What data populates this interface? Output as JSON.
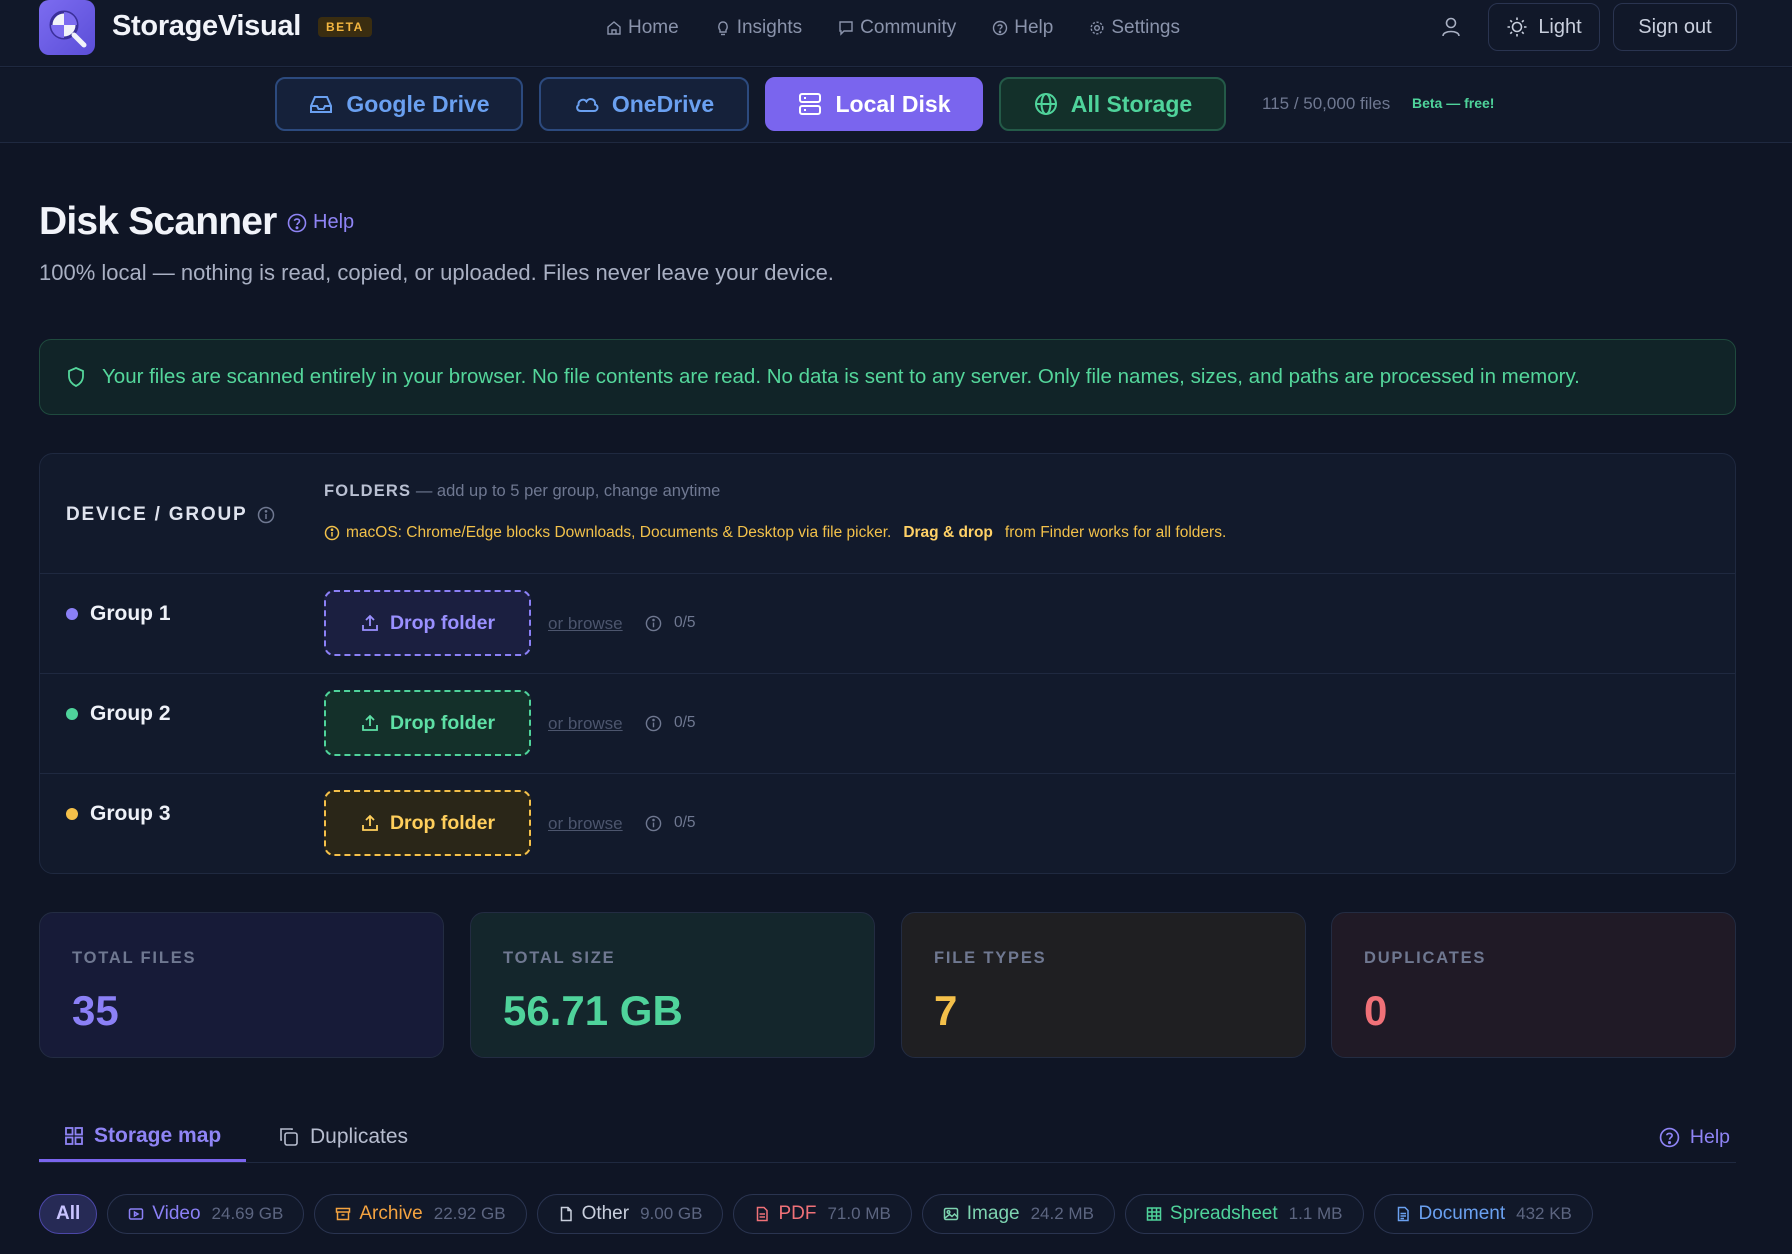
{
  "app": {
    "name": "StorageVisual",
    "badge": "BETA"
  },
  "nav": [
    {
      "label": "Home",
      "icon": "home-icon"
    },
    {
      "label": "Insights",
      "icon": "lightbulb-icon"
    },
    {
      "label": "Community",
      "icon": "chat-icon"
    },
    {
      "label": "Help",
      "icon": "help-icon"
    },
    {
      "label": "Settings",
      "icon": "gear-icon"
    }
  ],
  "header_actions": {
    "theme_label": "Light",
    "signout_label": "Sign out"
  },
  "sources": {
    "tabs": [
      {
        "label": "Google Drive",
        "icon": "drive-icon",
        "active": false
      },
      {
        "label": "OneDrive",
        "icon": "cloud-icon",
        "active": false
      },
      {
        "label": "Local Disk",
        "icon": "server-icon",
        "active": true
      },
      {
        "label": "All Storage",
        "icon": "globe-icon",
        "active": false
      }
    ],
    "file_count": "115 / 50,000 files",
    "beta_note": "Beta — free!"
  },
  "page": {
    "title": "Disk Scanner",
    "help_label": "Help",
    "subtitle": "100% local — nothing is read, copied, or uploaded. Files never leave your device.",
    "privacy_notice": "Your files are scanned entirely in your browser. No file contents are read. No data is sent to any server. Only file names, sizes, and paths are processed in memory."
  },
  "groups_panel": {
    "device_group_label": "DEVICE / GROUP",
    "folders_label": "FOLDERS",
    "folders_hint": "— add up to 5 per group, change anytime",
    "mac_note_before": "macOS: Chrome/Edge blocks Downloads, Documents & Desktop via file picker.",
    "mac_note_bold": "Drag & drop",
    "mac_note_after": "from Finder works for all folders.",
    "groups": [
      {
        "name": "Group 1",
        "drop_label": "Drop folder",
        "browse_label": "or browse",
        "count": "0/5",
        "color": "#8b80f6"
      },
      {
        "name": "Group 2",
        "drop_label": "Drop folder",
        "browse_label": "or browse",
        "count": "0/5",
        "color": "#4fd39b"
      },
      {
        "name": "Group 3",
        "drop_label": "Drop folder",
        "browse_label": "or browse",
        "count": "0/5",
        "color": "#f4c04a"
      }
    ]
  },
  "stats": [
    {
      "label": "TOTAL FILES",
      "value": "35",
      "color": "#8b80f6"
    },
    {
      "label": "TOTAL SIZE",
      "value": "56.71 GB",
      "color": "#4fd39b"
    },
    {
      "label": "FILE TYPES",
      "value": "7",
      "color": "#f4c04a"
    },
    {
      "label": "DUPLICATES",
      "value": "0",
      "color": "#f07178"
    }
  ],
  "view_tabs": {
    "storage_map": "Storage map",
    "duplicates": "Duplicates",
    "help": "Help"
  },
  "filters": [
    {
      "label": "All",
      "size": ""
    },
    {
      "label": "Video",
      "size": "24.69 GB",
      "color": "#8b80f6",
      "icon": "video-icon"
    },
    {
      "label": "Archive",
      "size": "22.92 GB",
      "color": "#f4a340",
      "icon": "archive-icon"
    },
    {
      "label": "Other",
      "size": "9.00 GB",
      "color": "#c9cfdd",
      "icon": "file-icon"
    },
    {
      "label": "PDF",
      "size": "71.0 MB",
      "color": "#f07178",
      "icon": "pdf-icon"
    },
    {
      "label": "Image",
      "size": "24.2 MB",
      "color": "#7dd3b0",
      "icon": "image-icon"
    },
    {
      "label": "Spreadsheet",
      "size": "1.1 MB",
      "color": "#4fd39b",
      "icon": "spreadsheet-icon"
    },
    {
      "label": "Document",
      "size": "432 KB",
      "color": "#6aa0f0",
      "icon": "document-icon"
    }
  ]
}
